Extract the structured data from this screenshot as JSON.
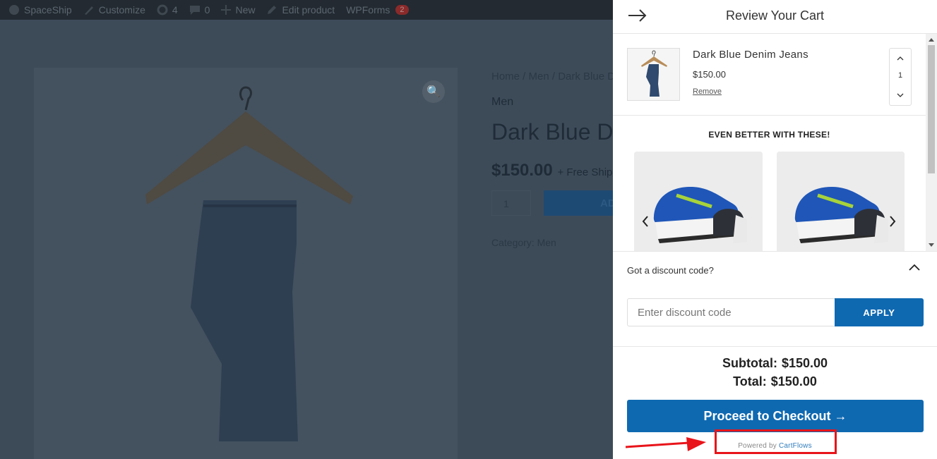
{
  "adminbar": {
    "items": [
      {
        "label": "SpaceShip",
        "icon": "dashboard-icon"
      },
      {
        "label": "Customize",
        "icon": "brush-icon"
      },
      {
        "label": "4",
        "icon": "updates-icon"
      },
      {
        "label": "0",
        "icon": "comment-icon"
      },
      {
        "label": "New",
        "icon": "plus-icon"
      },
      {
        "label": "Edit product",
        "icon": "pencil-icon"
      },
      {
        "label": "WPForms",
        "badge": "2"
      }
    ]
  },
  "page": {
    "breadcrumb": "Home / Men / Dark Blue De",
    "category_top": "Men",
    "title": "Dark Blue De",
    "price": "$150.00",
    "shipping": "+ Free Shipp",
    "qty": "1",
    "add_label": "AD",
    "category_label": "Category:",
    "category_value": "Men"
  },
  "cart": {
    "title": "Review Your Cart",
    "item": {
      "name": "Dark Blue Denim Jeans",
      "price": "$150.00",
      "remove": "Remove",
      "qty": "1"
    },
    "upsell_title": "EVEN BETTER WITH THESE!",
    "discount": {
      "label": "Got a discount code?",
      "placeholder": "Enter discount code",
      "apply": "APPLY"
    },
    "subtotal_label": "Subtotal:",
    "subtotal_value": "$150.00",
    "total_label": "Total:",
    "total_value": "$150.00",
    "checkout_label": "Proceed to Checkout →",
    "powered_prefix": "Powered by",
    "powered_brand": "CartFlows"
  },
  "colors": {
    "accent": "#0f69b1",
    "annotation": "#e8141a",
    "overlay": "#3d4b59"
  }
}
